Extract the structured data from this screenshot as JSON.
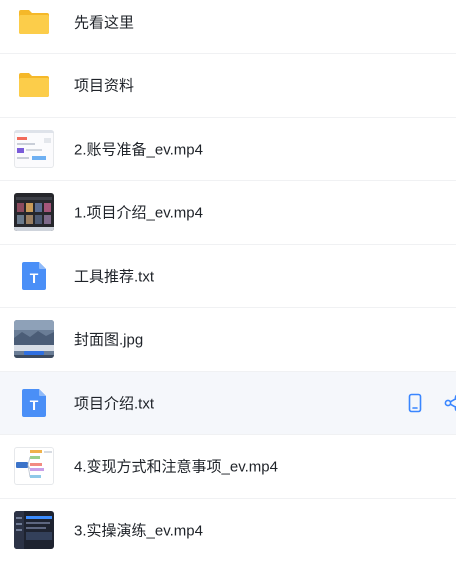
{
  "files": [
    {
      "name": "先看这里",
      "kind": "folder"
    },
    {
      "name": "项目资料",
      "kind": "folder"
    },
    {
      "name": "2.账号准备_ev.mp4",
      "kind": "video-light"
    },
    {
      "name": "1.项目介绍_ev.mp4",
      "kind": "video-dark"
    },
    {
      "name": "工具推荐.txt",
      "kind": "txt"
    },
    {
      "name": "封面图.jpg",
      "kind": "image"
    },
    {
      "name": "项目介绍.txt",
      "kind": "txt",
      "selected": true
    },
    {
      "name": "4.变现方式和注意事项_ev.mp4",
      "kind": "video-mindmap"
    },
    {
      "name": "3.实操演练_ev.mp4",
      "kind": "video-screen"
    }
  ],
  "icons": {
    "folder": "folder-icon",
    "txt": "txt-file-icon",
    "txt_letter": "T",
    "phone": "phone-icon",
    "share": "share-icon"
  },
  "colors": {
    "folder": "#f9c23c",
    "txt": "#4a8ff7",
    "action": "#3a86ff",
    "highlight": "#f5f7fb"
  }
}
